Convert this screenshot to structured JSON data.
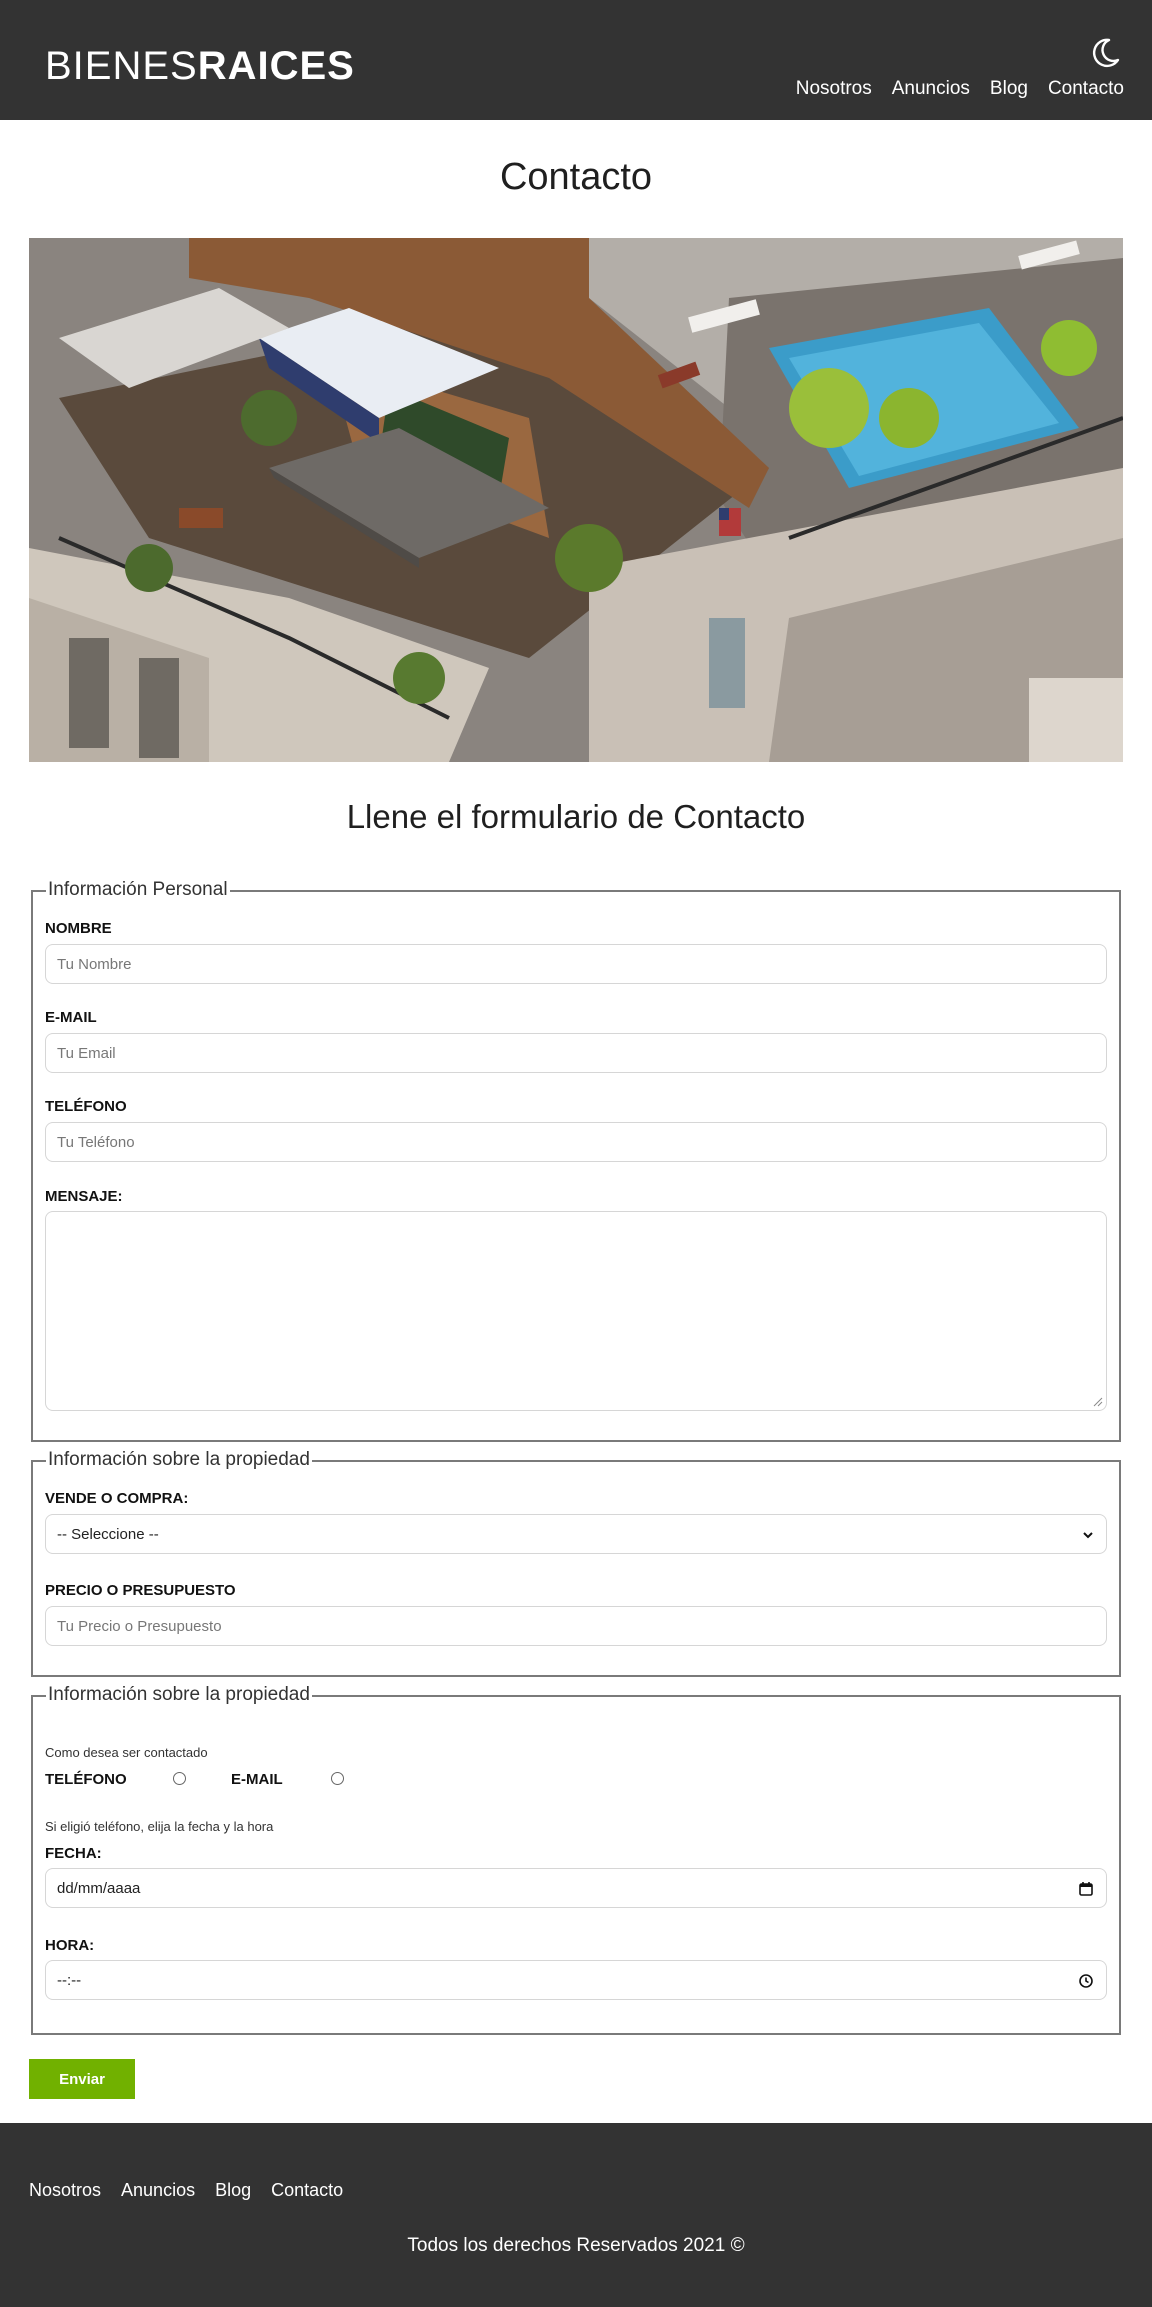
{
  "header": {
    "logo_light": "BIENES",
    "logo_bold": "RAICES",
    "theme_icon": "moon-icon",
    "nav": [
      "Nosotros",
      "Anuncios",
      "Blog",
      "Contacto"
    ]
  },
  "page_title": "Contacto",
  "hero_image": "rooftop-terrace-with-pool-photo",
  "form_title": "Llene el formulario de Contacto",
  "personal": {
    "legend": "Información Personal",
    "name_label": "Nombre",
    "name_placeholder": "Tu Nombre",
    "email_label": "E-mail",
    "email_placeholder": "Tu Email",
    "phone_label": "Teléfono",
    "phone_placeholder": "Tu Teléfono",
    "message_label": "Mensaje:"
  },
  "property": {
    "legend": "Información sobre la propiedad",
    "type_label": "Vende o Compra:",
    "type_selected": "-- Seleccione --",
    "price_label": "Precio o Presupuesto",
    "price_placeholder": "Tu Precio o Presupuesto"
  },
  "contact": {
    "legend": "Información sobre la propiedad",
    "how_text": "Como desea ser contactado",
    "phone_option": "Teléfono",
    "email_option": "E-mail",
    "phone_hint": "Si eligió teléfono, elija la fecha y la hora",
    "date_label": "Fecha:",
    "date_value": "dd/mm/aaaa",
    "time_label": "Hora:",
    "time_value": "--:--"
  },
  "submit_label": "Enviar",
  "footer": {
    "nav": [
      "Nosotros",
      "Anuncios",
      "Blog",
      "Contacto"
    ],
    "copyright": "Todos los derechos Reservados 2021 ©"
  },
  "colors": {
    "header_bg": "#333333",
    "accent_green": "#71b100",
    "border_gray": "#7a7a7a"
  }
}
